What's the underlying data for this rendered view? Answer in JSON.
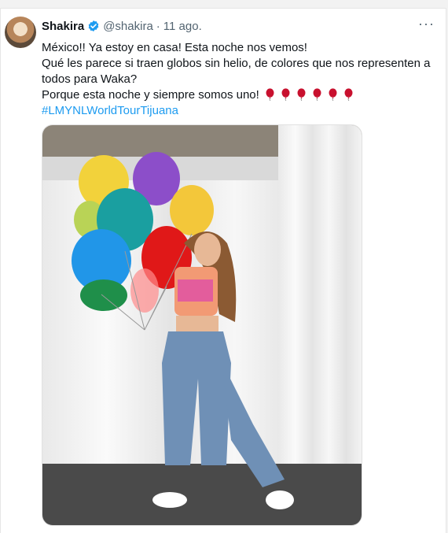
{
  "tweet": {
    "display_name": "Shakira",
    "handle": "@shakira",
    "separator": "·",
    "time": "11 ago.",
    "more_label": "···",
    "lines": [
      "México!! Ya estoy en casa! Esta noche nos vemos!",
      "Qué les parece si traen globos sin helio, de colores que nos representen a todos para Waka?",
      "Porque esta noche y siempre somos uno!"
    ],
    "hashtag": "#LMYNLWorldTourTijuana",
    "emoji_count": 6,
    "icons": {
      "verified": "verified-badge-icon",
      "more": "more-dots-icon",
      "emoji": "red-balloon-emoji"
    },
    "colors": {
      "accent": "#1d9bf0",
      "text": "#0f1419",
      "muted": "#536471"
    }
  }
}
